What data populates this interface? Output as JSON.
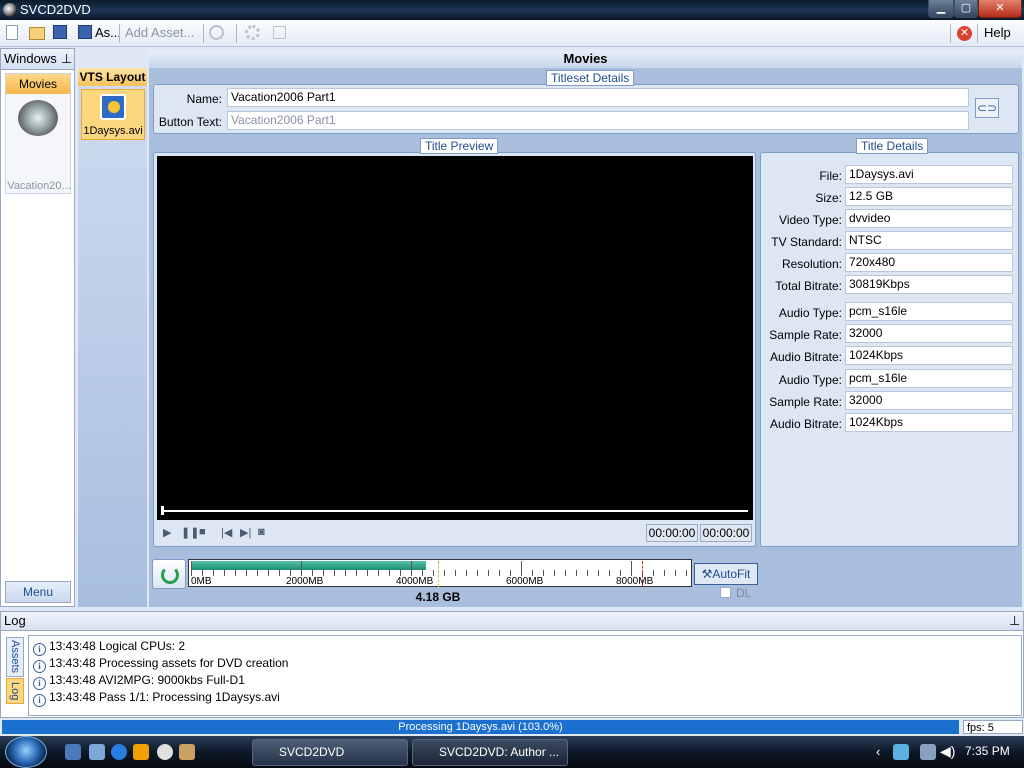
{
  "window": {
    "title": "SVCD2DVD",
    "min": "▁",
    "max": "▢",
    "close": "✕"
  },
  "toolbar": {
    "save_as": "As...",
    "add_asset": "Add Asset...",
    "help": "Help"
  },
  "left": {
    "header": "Windows",
    "pin": "⊥",
    "movies": "Movies",
    "movie_label": "Vacation20...",
    "menu": "Menu"
  },
  "vts": {
    "header": "VTS Layout",
    "item": "1Daysys.avi"
  },
  "main": {
    "header": "Movies"
  },
  "titleset": {
    "title": "Titleset Details",
    "name_label": "Name:",
    "name_value": "Vacation2006 Part1",
    "button_label": "Button Text:",
    "button_placeholder": "Vacation2006 Part1"
  },
  "preview": {
    "title": "Title Preview",
    "time1": "00:00:00",
    "time2": "00:00:00"
  },
  "details": {
    "title": "Title Details",
    "rows": [
      {
        "label": "File:",
        "value": "1Daysys.avi"
      },
      {
        "label": "Size:",
        "value": "12.5 GB"
      },
      {
        "label": "Video Type:",
        "value": "dvvideo"
      },
      {
        "label": "TV Standard:",
        "value": "NTSC"
      },
      {
        "label": "Resolution:",
        "value": "720x480"
      },
      {
        "label": "Total Bitrate:",
        "value": "30819Kbps"
      },
      {
        "label": "Audio Type:",
        "value": "pcm_s16le"
      },
      {
        "label": "Sample Rate:",
        "value": "32000"
      },
      {
        "label": "Audio Bitrate:",
        "value": "1024Kbps"
      },
      {
        "label": "Audio Type:",
        "value": "pcm_s16le"
      },
      {
        "label": "Sample Rate:",
        "value": "32000"
      },
      {
        "label": "Audio Bitrate:",
        "value": "1024Kbps"
      }
    ]
  },
  "capacity": {
    "labels": [
      "0MB",
      "2000MB",
      "4000MB",
      "6000MB",
      "8000MB"
    ],
    "used": "4.18 GB",
    "used_fraction": 0.47,
    "autofit": "AutoFit",
    "dl": "DL"
  },
  "log": {
    "header": "Log",
    "tabs": [
      "Assets",
      "Log"
    ],
    "lines": [
      "13:43:48  Logical CPUs: 2",
      "13:43:48  Processing assets for DVD creation",
      "13:43:48  AVI2MPG: 9000kbs Full-D1",
      "13:43:48  Pass 1/1: Processing 1Daysys.avi"
    ]
  },
  "status": {
    "progress": "Processing 1Daysys.avi (103.0%)",
    "fps": "fps: 5"
  },
  "taskbar": {
    "task1": "SVCD2DVD",
    "task2": "SVCD2DVD: Author ...",
    "clock": "7:35 PM"
  },
  "colors": {
    "accent": "#1f4e8c",
    "progress": "#1b6fce",
    "capacity": "#1c8c74"
  }
}
